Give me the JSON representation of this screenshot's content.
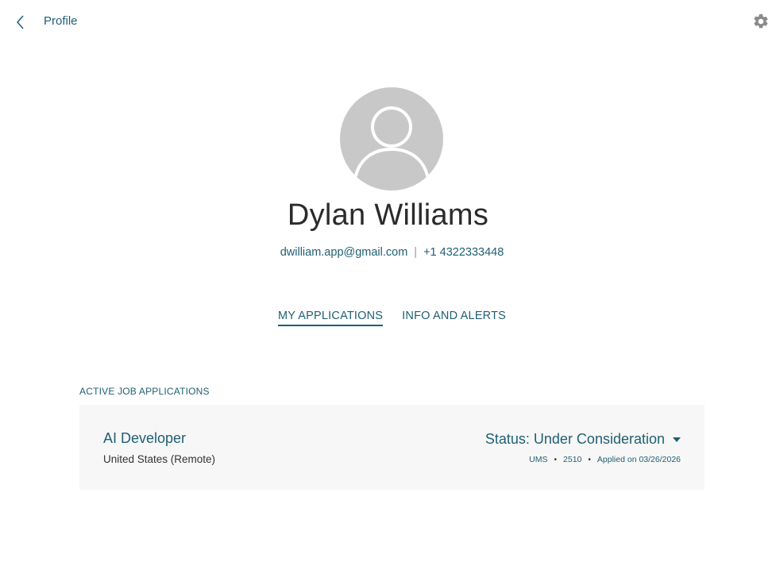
{
  "header": {
    "title": "Profile",
    "back_icon": "chevron-left-icon",
    "settings_icon": "gear-icon"
  },
  "profile": {
    "name": "Dylan Williams",
    "email": "dwilliam.app@gmail.com",
    "separator": "|",
    "phone": "+1 4322333448",
    "avatar_icon": "user-avatar-icon"
  },
  "tabs": [
    {
      "label": "MY APPLICATIONS",
      "active": true
    },
    {
      "label": "INFO AND ALERTS",
      "active": false
    }
  ],
  "applications": {
    "section_label": "ACTIVE JOB APPLICATIONS",
    "items": [
      {
        "title": "AI Developer",
        "location": "United States (Remote)",
        "status": "Status: Under Consideration",
        "meta": [
          "UMS",
          "2510",
          "Applied on 03/26/2026"
        ]
      }
    ]
  },
  "colors": {
    "accent": "#1f5f73",
    "card_bg": "#f7f7f7",
    "avatar_bg": "#c8c8c8",
    "icon_gray": "#8a8a8a"
  }
}
